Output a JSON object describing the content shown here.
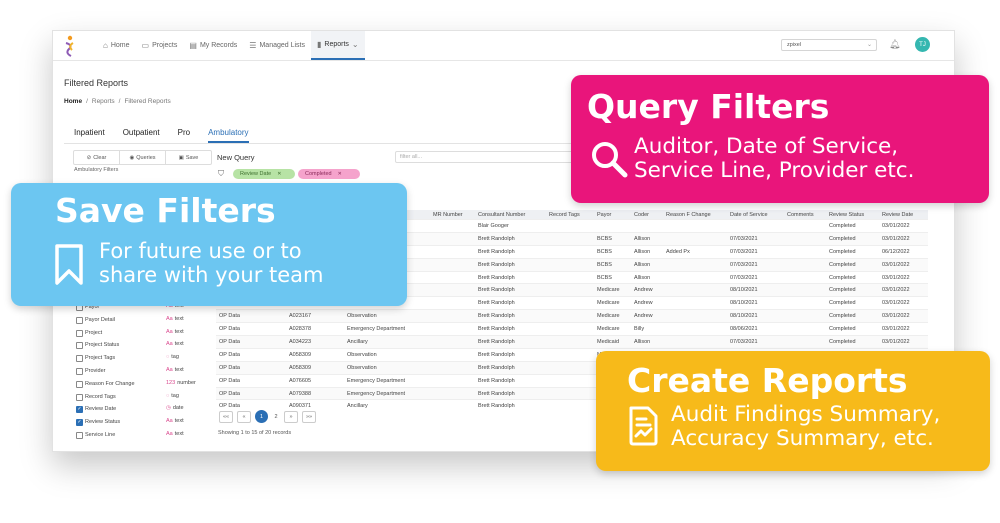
{
  "nav": {
    "items": [
      {
        "label": "Home",
        "icon": "home-icon"
      },
      {
        "label": "Projects",
        "icon": "briefcase-icon"
      },
      {
        "label": "My Records",
        "icon": "document-icon"
      },
      {
        "label": "Managed Lists",
        "icon": "list-icon"
      },
      {
        "label": "Reports",
        "icon": "bar-chart-icon",
        "active": true
      }
    ],
    "user_select": "zpixel",
    "avatar_initials": "TJ"
  },
  "page": {
    "title": "Filtered Reports",
    "breadcrumb": [
      "Home",
      "Reports",
      "Filtered Reports"
    ]
  },
  "tabs": [
    "Inpatient",
    "Outpatient",
    "Pro",
    "Ambulatory"
  ],
  "active_tab": "Ambulatory",
  "sidebar": {
    "tools": [
      "Clear",
      "Queries",
      "Save"
    ],
    "title": "Ambulatory Filters",
    "fields": [
      {
        "name": "Payor",
        "type": "text",
        "checked": false
      },
      {
        "name": "Payor Detail",
        "type": "text",
        "checked": false
      },
      {
        "name": "Project",
        "type": "text",
        "checked": false
      },
      {
        "name": "Project Status",
        "type": "text",
        "checked": false
      },
      {
        "name": "Project Tags",
        "type": "tag",
        "checked": false
      },
      {
        "name": "Provider",
        "type": "text",
        "checked": false
      },
      {
        "name": "Reason For Change",
        "type": "number",
        "checked": false
      },
      {
        "name": "Record Tags",
        "type": "tag",
        "checked": false
      },
      {
        "name": "Review Date",
        "type": "date",
        "checked": true
      },
      {
        "name": "Review Status",
        "type": "text",
        "checked": true
      },
      {
        "name": "Service Line",
        "type": "text",
        "checked": false
      }
    ]
  },
  "query": {
    "label": "New Query",
    "search_placeholder": "filter all...",
    "chips": [
      "Review Date",
      "Completed"
    ]
  },
  "table": {
    "columns": [
      "",
      "",
      "",
      "MR Number",
      "Consultant Number",
      "Record Tags",
      "Payor",
      "Coder",
      "Reason F Change",
      "Date of Service",
      "Comments",
      "Review Status",
      "Review Date"
    ],
    "rows": [
      [
        "",
        "",
        "",
        "",
        "Blair Googer",
        "",
        "",
        "",
        "",
        "",
        "",
        "Completed",
        "03/01/2022"
      ],
      [
        "",
        "",
        "",
        "",
        "Brett Randolph",
        "",
        "BCBS",
        "Allison",
        "",
        "07/03/2021",
        "",
        "Completed",
        "03/01/2022"
      ],
      [
        "",
        "",
        "",
        "",
        "Brett Randolph",
        "",
        "BCBS",
        "Allison",
        "Added Px",
        "07/03/2021",
        "",
        "Completed",
        "06/12/2022"
      ],
      [
        "",
        "",
        "",
        "",
        "Brett Randolph",
        "",
        "BCBS",
        "Allison",
        "",
        "07/03/2021",
        "",
        "Completed",
        "03/01/2022"
      ],
      [
        "",
        "",
        "",
        "",
        "Brett Randolph",
        "",
        "BCBS",
        "Allison",
        "",
        "07/03/2021",
        "",
        "Completed",
        "03/01/2022"
      ],
      [
        "",
        "",
        "",
        "",
        "Brett Randolph",
        "",
        "Medicare",
        "Andrew",
        "",
        "08/10/2021",
        "",
        "Completed",
        "03/01/2022"
      ],
      [
        "",
        "",
        "",
        "",
        "Brett Randolph",
        "",
        "Medicare",
        "Andrew",
        "",
        "08/10/2021",
        "",
        "Completed",
        "03/01/2022"
      ],
      [
        "OP Data",
        "A023167",
        "Observation",
        "",
        "Brett Randolph",
        "",
        "Medicare",
        "Andrew",
        "",
        "08/10/2021",
        "",
        "Completed",
        "03/01/2022"
      ],
      [
        "OP Data",
        "A028378",
        "Emergency Department",
        "",
        "Brett Randolph",
        "",
        "Medicare",
        "Billy",
        "",
        "08/06/2021",
        "",
        "Completed",
        "03/01/2022"
      ],
      [
        "OP Data",
        "A034223",
        "Ancillary",
        "",
        "Brett Randolph",
        "",
        "Medicaid",
        "Allison",
        "",
        "07/03/2021",
        "",
        "Completed",
        "03/01/2022"
      ],
      [
        "OP Data",
        "A058309",
        "Observation",
        "",
        "Brett Randolph",
        "",
        "Medicare",
        "Andrew",
        "",
        "08/10/2021",
        "",
        "Completed",
        "03/01/2022"
      ],
      [
        "OP Data",
        "A058309",
        "Observation",
        "",
        "Brett Randolph",
        "",
        "M",
        "",
        "",
        "",
        "",
        "",
        ""
      ],
      [
        "OP Data",
        "A076605",
        "Emergency Department",
        "",
        "Brett Randolph",
        "",
        "",
        "",
        "",
        "",
        "",
        "",
        ""
      ],
      [
        "OP Data",
        "A079388",
        "Emergency Department",
        "",
        "Brett Randolph",
        "",
        "",
        "",
        "",
        "",
        "",
        "",
        ""
      ],
      [
        "OP Data",
        "A090371",
        "Ancillary",
        "",
        "Brett Randolph",
        "",
        "",
        "",
        "",
        "",
        "",
        "",
        ""
      ]
    ]
  },
  "pagination": {
    "first": "««",
    "prev": "«",
    "pages": [
      "1",
      "2"
    ],
    "current": "1",
    "next": "»",
    "last": "»»",
    "showing": "Showing 1 to 15 of 20 records"
  },
  "callouts": {
    "query": {
      "title": "Query Filters",
      "line1": "Auditor, Date of Service,",
      "line2": "Service Line, Provider etc.",
      "icon": "search-icon",
      "color": "#e9157b"
    },
    "save": {
      "title": "Save Filters",
      "line1": "For future use or to",
      "line2": "share with your team",
      "icon": "bookmark-icon",
      "color": "#6cc6f1"
    },
    "create": {
      "title": "Create Reports",
      "line1": "Audit Findings Summary,",
      "line2": "Accuracy Summary, etc.",
      "icon": "report-document-icon",
      "color": "#f7ba1a"
    }
  }
}
